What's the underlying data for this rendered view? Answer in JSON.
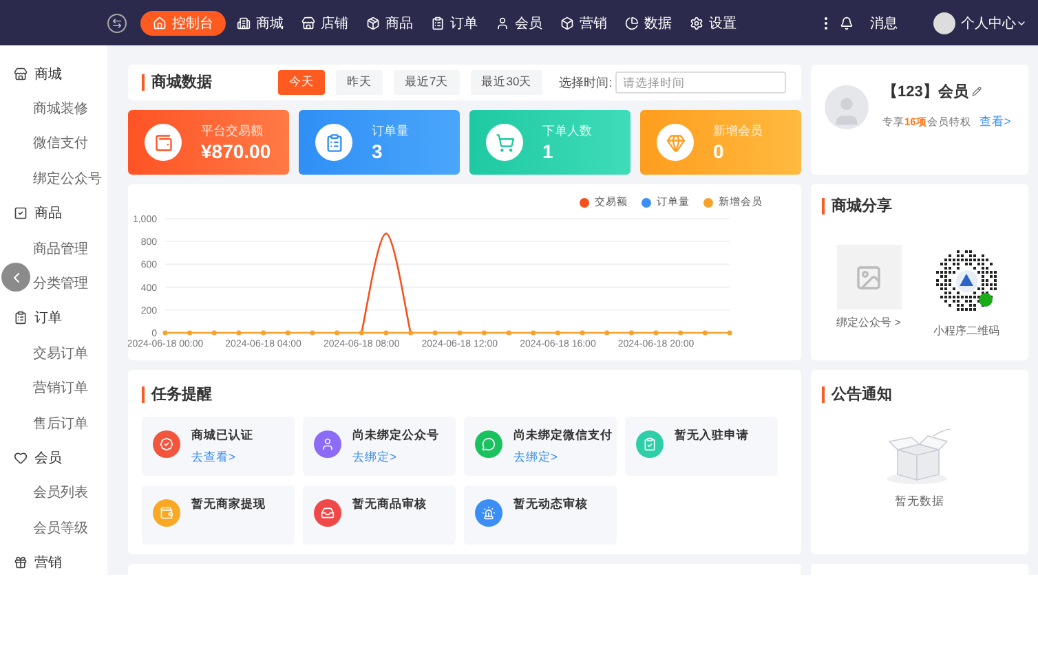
{
  "nav": {
    "items": [
      {
        "label": "控制台",
        "selected": true
      },
      {
        "label": "商城",
        "selected": false
      },
      {
        "label": "店铺",
        "selected": false
      },
      {
        "label": "商品",
        "selected": false
      },
      {
        "label": "订单",
        "selected": false
      },
      {
        "label": "会员",
        "selected": false
      },
      {
        "label": "营销",
        "selected": false
      },
      {
        "label": "数据",
        "selected": false
      },
      {
        "label": "设置",
        "selected": false
      }
    ],
    "message_label": "消息",
    "user_label": "个人中心"
  },
  "sidebar": {
    "groups": [
      {
        "label": "商城",
        "children": [
          {
            "label": "商城装修"
          },
          {
            "label": "微信支付"
          },
          {
            "label": "绑定公众号"
          }
        ]
      },
      {
        "label": "商品",
        "children": [
          {
            "label": "商品管理"
          },
          {
            "label": "分类管理"
          }
        ]
      },
      {
        "label": "订单",
        "children": [
          {
            "label": "交易订单"
          },
          {
            "label": "营销订单"
          },
          {
            "label": "售后订单"
          }
        ]
      },
      {
        "label": "会员",
        "children": [
          {
            "label": "会员列表"
          },
          {
            "label": "会员等级"
          }
        ]
      },
      {
        "label": "营销"
      }
    ]
  },
  "mall_data": {
    "title": "商城数据",
    "ranges": [
      {
        "label": "今天",
        "selected": true
      },
      {
        "label": "昨天",
        "selected": false
      },
      {
        "label": "最近7天",
        "selected": false
      },
      {
        "label": "最近30天",
        "selected": false
      }
    ],
    "picker_label": "选择时间:",
    "picker_placeholder": "请选择时间"
  },
  "stats": [
    {
      "kind": "sales",
      "label": "平台交易额",
      "value": "¥870.00"
    },
    {
      "kind": "orders",
      "label": "订单量",
      "value": "3"
    },
    {
      "kind": "buyers",
      "label": "下单人数",
      "value": "1"
    },
    {
      "kind": "members",
      "label": "新增会员",
      "value": "0"
    }
  ],
  "trend": {
    "chart_data": {
      "type": "line",
      "categories": [
        "2024-06-18 00:00",
        null,
        null,
        null,
        "2024-06-18 04:00",
        null,
        null,
        null,
        "2024-06-18 08:00",
        null,
        null,
        null,
        "2024-06-18 12:00",
        null,
        null,
        null,
        "2024-06-18 16:00",
        null,
        null,
        null,
        "2024-06-18 20:00",
        null,
        null,
        null
      ],
      "series": [
        {
          "name": "交易额",
          "color": "#f4511e",
          "marker": "none",
          "values": [
            null,
            null,
            null,
            null,
            null,
            null,
            null,
            null,
            0,
            870,
            0,
            null,
            null,
            null,
            null,
            null,
            null,
            null,
            null,
            null,
            null,
            null,
            null,
            null
          ]
        },
        {
          "name": "订单量",
          "color": "#3a8ef6",
          "marker": "none",
          "values": [
            null,
            null,
            null,
            null,
            null,
            null,
            null,
            null,
            null,
            null,
            null,
            null,
            null,
            null,
            null,
            null,
            null,
            null,
            null,
            null,
            null,
            null,
            null,
            null
          ]
        },
        {
          "name": "新增会员",
          "color": "#f7a22c",
          "marker": "circle",
          "values": [
            0,
            0,
            0,
            0,
            0,
            0,
            0,
            0,
            0,
            0,
            0,
            0,
            0,
            0,
            0,
            0,
            0,
            0,
            0,
            0,
            0,
            0,
            0,
            0
          ]
        }
      ],
      "grid": true,
      "legend": true,
      "ylim": [
        0,
        1000
      ],
      "yticks": [
        0,
        200,
        400,
        600,
        800,
        {
          "value": 1000,
          "label": "1,000"
        }
      ]
    }
  },
  "tasks": {
    "title": "任务提醒",
    "items": [
      {
        "kind": "certified",
        "color": "#f2553d",
        "title": "商城已认证",
        "link": "去查看>"
      },
      {
        "kind": "account",
        "color": "#8c6cf5",
        "title": "尚未绑定公众号",
        "link": "去绑定>"
      },
      {
        "kind": "wechat",
        "color": "#19c15f",
        "title": "尚未绑定微信支付",
        "link": "去绑定>"
      },
      {
        "kind": "apply",
        "color": "#2ccfa8",
        "title": "暂无入驻申请"
      },
      {
        "kind": "withdraw",
        "color": "#f9a825",
        "title": "暂无商家提现"
      },
      {
        "kind": "goods",
        "color": "#f04848",
        "title": "暂无商品审核"
      },
      {
        "kind": "alert",
        "color": "#3a8ef6",
        "title": "暂无动态审核"
      }
    ]
  },
  "member": {
    "name": "【123】会员",
    "benefit": "专享**16项**会员特权",
    "link": "查看>"
  },
  "share": {
    "title": "商城分享",
    "items": [
      {
        "kind": "image",
        "label": "绑定公众号 >"
      },
      {
        "kind": "qrcode",
        "label": "小程序二维码"
      }
    ]
  },
  "notice": {
    "title": "公告通知",
    "empty_text": "暂无数据"
  }
}
